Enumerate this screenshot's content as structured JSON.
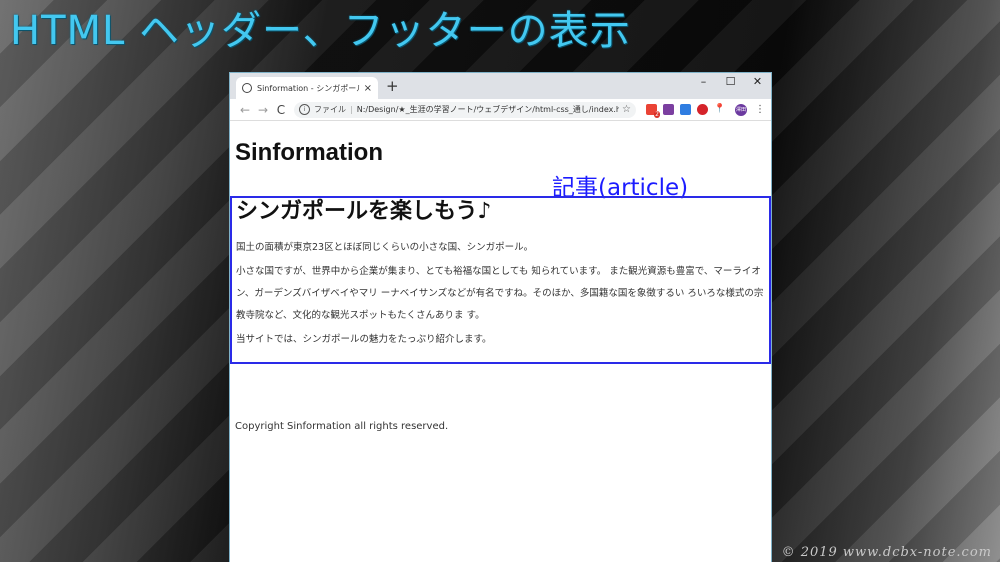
{
  "slide": {
    "title": "HTML ヘッダー、フッターの表示",
    "watermark": "© 2019 www.dcbx-note.com"
  },
  "browser": {
    "tab_title": "Sinformation - シンガポールの観光",
    "tab_close": "×",
    "new_tab": "+",
    "window_controls": {
      "minimize": "–",
      "maximize": "☐",
      "close": "✕"
    },
    "nav": {
      "back": "←",
      "forward": "→",
      "reload": "C"
    },
    "address": {
      "label": "ファイル",
      "separator": "|",
      "url": "N:/Design/★_生涯の学習ノート/ウェブデザイン/html-css_通し/index.ht..."
    },
    "extensions": {
      "badge_count": "2",
      "avatar": "澤田"
    }
  },
  "page": {
    "site_title": "Sinformation",
    "annotation": "記事(article)",
    "article": {
      "heading": "シンガポールを楽しもう♪",
      "paragraphs": [
        "国土の面積が東京23区とほぼ同じくらいの小さな国、シンガポール。",
        "小さな国ですが、世界中から企業が集まり、とても裕福な国としても 知られています。 また観光資源も豊富で、マーライオン、ガーデンズバイザベイやマリ ーナベイサンズなどが有名ですね。そのほか、多国籍な国を象徴するい ろいろな様式の宗教寺院など、文化的な観光スポットもたくさんありま す。",
        "当サイトでは、シンガポールの魅力をたっぷり紹介します。"
      ]
    },
    "footer": "Copyright Sinformation all rights reserved."
  },
  "colors": {
    "slide_title": "#43c8f0",
    "article_border": "#2a2ae8",
    "annotation": "#1c1cff"
  }
}
